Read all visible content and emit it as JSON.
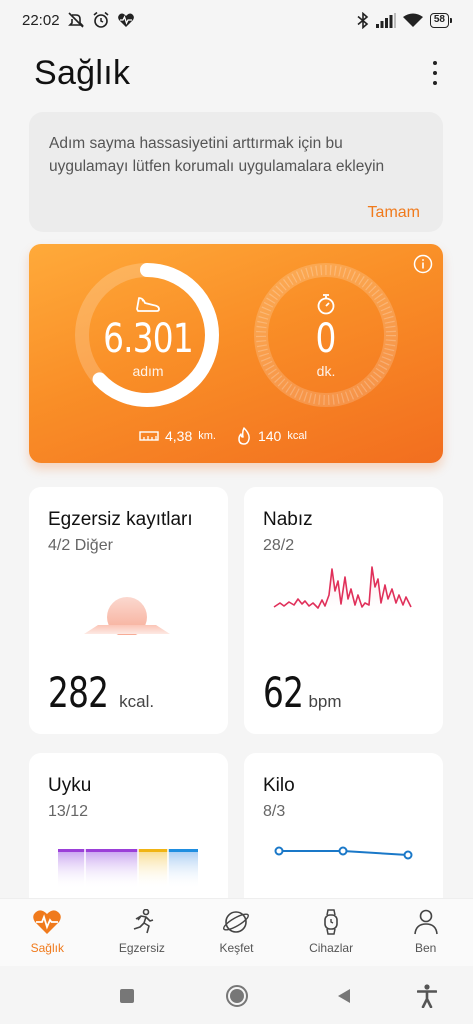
{
  "status_bar": {
    "time": "22:02",
    "battery": "58"
  },
  "header": {
    "title": "Sağlık"
  },
  "notice": {
    "message": "Adım sayma hassasiyetini arttırmak için bu uygulamayı lütfen korumalı uygulamalara ekleyin",
    "action_label": "Tamam"
  },
  "activity": {
    "steps_value": "6.301",
    "steps_unit": "adım",
    "steps_progress": 0.63,
    "minutes_value": "0",
    "minutes_unit": "dk.",
    "distance_value": "4,38",
    "distance_unit": "km.",
    "calories_value": "140",
    "calories_unit": "kcal"
  },
  "cards": {
    "exercise": {
      "title": "Egzersiz kayıtları",
      "date": "4/2 Diğer",
      "value": "282",
      "unit": "kcal."
    },
    "heart": {
      "title": "Nabız",
      "date": "28/2",
      "value": "62",
      "unit": "bpm"
    },
    "sleep": {
      "title": "Uyku",
      "date": "13/12"
    },
    "weight": {
      "title": "Kilo",
      "date": "8/3"
    }
  },
  "nav": {
    "items": [
      {
        "label": "Sağlık",
        "icon": "heart-pulse-icon",
        "active": true
      },
      {
        "label": "Egzersiz",
        "icon": "runner-icon",
        "active": false
      },
      {
        "label": "Keşfet",
        "icon": "planet-icon",
        "active": false
      },
      {
        "label": "Cihazlar",
        "icon": "watch-icon",
        "active": false
      },
      {
        "label": "Ben",
        "icon": "person-icon",
        "active": false
      }
    ]
  },
  "colors": {
    "accent": "#f07a1c",
    "heart_line": "#e0305a",
    "weight_line": "#1a78c8"
  }
}
